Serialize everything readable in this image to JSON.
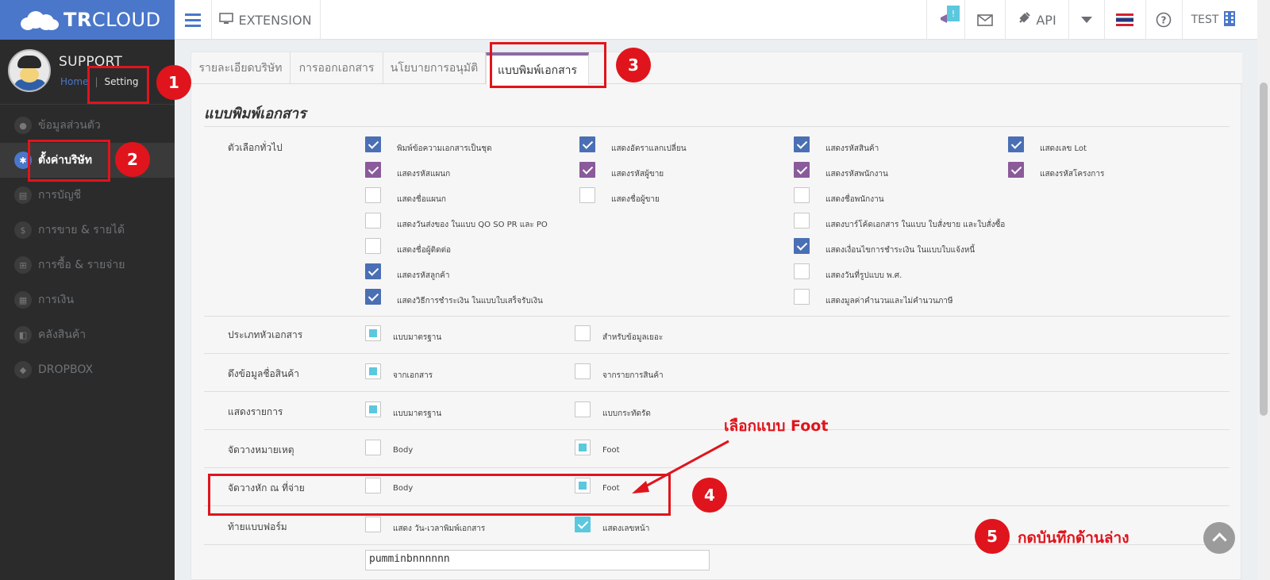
{
  "brand": {
    "bold": "TR",
    "rest": "CLOUD"
  },
  "topbar": {
    "menu_icon": "hamburger-icon",
    "extension_label": "EXTENSION",
    "alert_badge": "!",
    "api_label": "API",
    "user_label": "TEST"
  },
  "profile": {
    "name": "SUPPORT",
    "home": "Home",
    "current": "Setting"
  },
  "sidebar": {
    "items": [
      {
        "label": "ข้อมูลส่วนตัว",
        "icon": "user-icon"
      },
      {
        "label": "ตั้งค่าบริษัท",
        "icon": "gear-icon"
      },
      {
        "label": "การบัญชี",
        "icon": "book-icon"
      },
      {
        "label": "การขาย & รายได้",
        "icon": "dollar-icon"
      },
      {
        "label": "การซื้อ & รายจ่าย",
        "icon": "cart-icon"
      },
      {
        "label": "การเงิน",
        "icon": "calendar-icon"
      },
      {
        "label": "คลังสินค้า",
        "icon": "box-icon"
      },
      {
        "label": "DROPBOX",
        "icon": "dropbox-icon"
      }
    ]
  },
  "tabs": [
    "รายละเอียดบริษัท",
    "การออกเอกสาร",
    "นโยบายการอนุมัติ",
    "แบบพิมพ์เอกสาร"
  ],
  "section_title": "แบบพิมพ์เอกสาร",
  "rows": {
    "general": "ตัวเลือกทั่วไป",
    "doc_header": "ประเภทหัวเอกสาร",
    "product_name": "ดึงข้อมูลชื่อสินค้า",
    "show_items": "แสดงรายการ",
    "note_place": "จัดวางหมายเหตุ",
    "wht_place": "จัดวางหัก ณ ที่จ่าย",
    "footer": "ท้ายแบบฟอร์ม",
    "textbox_value": "pumminbnnnnnn"
  },
  "general_options": [
    "พิมพ์ข้อความเอกสารเป็นชุด",
    "แสดงอัตราแลกเปลี่ยน",
    "แสดงรหัสสินค้า",
    "แสดงเลข Lot",
    "แสดงรหัสแผนก",
    "แสดงรหัสผู้ขาย",
    "แสดงรหัสพนักงาน",
    "แสดงรหัสโครงการ",
    "แสดงชื่อแผนก",
    "แสดงชื่อผู้ขาย",
    "แสดงชื่อพนักงาน",
    "แสดงวันส่งของ ในแบบ QO SO PR และ PO",
    "แสดงบาร์โค้ดเอกสาร ในแบบ ใบสั่งขาย และใบสั่งซื้อ",
    "แสดงชื่อผู้ติดต่อ",
    "แสดงเงื่อนไขการชำระเงิน ในแบบใบแจ้งหนี้",
    "แสดงรหัสลูกค้า",
    "แสดงวันที่รูปแบบ พ.ศ.",
    "แสดงวิธีการชำระเงิน ในแบบใบเสร็จรับเงิน",
    "แสดงมูลค่าคำนวนและไม่คำนวนภาษี"
  ],
  "choice_labels": {
    "standard": "แบบมาตรฐาน",
    "data_user": "สำหรับข้อมูลเยอะ",
    "from_doc": "จากเอกสาร",
    "from_product": "จากรายการสินค้า",
    "standard2": "แบบมาตรฐาน",
    "compact": "แบบกระทัดรัด",
    "body": "Body",
    "foot": "Foot",
    "body2": "Body",
    "foot2": "Foot",
    "show_datetime": "แสดง วัน-เวลาพิมพ์เอกสาร",
    "show_page": "แสดงเลขหน้า"
  },
  "annotations": {
    "n1": "1",
    "n2": "2",
    "n3": "3",
    "n4": "4",
    "n5": "5",
    "choose_foot": "เลือกแบบ Foot",
    "save_below": "กดบันทึกด้านล่าง"
  },
  "colors": {
    "brand": "#4a77c9",
    "sidebar": "#2b2b2b",
    "annotation": "#e0141c",
    "tab_accent": "#8b6aa5"
  }
}
